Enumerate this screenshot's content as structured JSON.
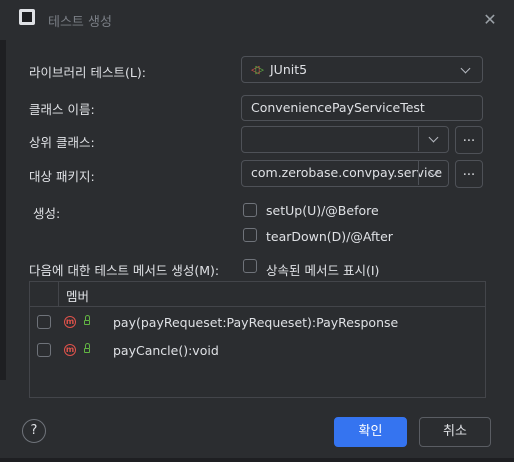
{
  "window": {
    "title": "테스트 생성"
  },
  "form": {
    "library_label": "라이브러리 테스트(L):",
    "library_value": "JUnit5",
    "class_name_label": "클래스 이름:",
    "class_name_value": "ConveniencePayServiceTest",
    "superclass_label": "상위 클래스:",
    "superclass_value": "",
    "package_label": "대상 패키지:",
    "package_value": "com.zerobase.convpay.service",
    "browse_label": "...",
    "generate_label": "생성:",
    "generate_options": [
      {
        "label": "setUp(U)/@Before",
        "checked": false
      },
      {
        "label": "tearDown(D)/@After",
        "checked": false
      }
    ],
    "methods_label": "다음에 대한 테스트 메서드 생성(M):",
    "show_inherited_label": "상속된 메서드 표시(I)",
    "show_inherited_checked": false
  },
  "members_table": {
    "column_header": "멤버",
    "rows": [
      {
        "signature": "pay(payRequeset:PayRequeset):PayResponse",
        "checked": false,
        "icon": "method-icon"
      },
      {
        "signature": "payCancle():void",
        "checked": false,
        "icon": "method-icon"
      }
    ]
  },
  "footer": {
    "help_label": "?",
    "ok_label": "확인",
    "cancel_label": "취소"
  },
  "colors": {
    "accent": "#3574f0",
    "background": "#2b2d30",
    "method_icon": "#e0524b",
    "access_icon": "#62b543"
  }
}
